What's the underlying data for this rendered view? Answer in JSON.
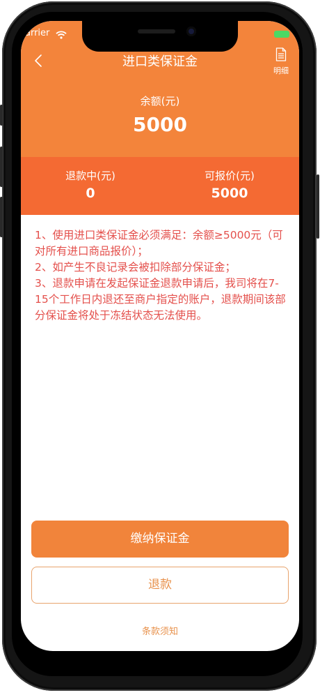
{
  "status_bar": {
    "carrier": "arrier"
  },
  "nav": {
    "title": "进口类保证金",
    "detail_label": "明细"
  },
  "balance": {
    "label": "余额(元)",
    "value": "5000"
  },
  "stats": [
    {
      "label": "退款中(元)",
      "value": "0"
    },
    {
      "label": "可报价(元)",
      "value": "5000"
    }
  ],
  "notice": {
    "lines": [
      "1、使用进口类保证金必须满足：余额≥5000元（可对所有进口商品报价）；",
      "2、如产生不良记录会被扣除部分保证金；",
      "3、退款申请在发起保证金退款申请后，我司将在7-15个工作日内退还至商户指定的账户，退款期间该部分保证金将处于冻结状态无法使用。"
    ]
  },
  "actions": {
    "pay_label": "缴纳保证金",
    "refund_label": "退款",
    "terms_label": "条款须知"
  },
  "colors": {
    "header": "#f3843b",
    "sub_panel": "#f46a33",
    "notice_text": "#e4504c",
    "primary_button": "#f1843b",
    "outline": "#e8a36c"
  }
}
